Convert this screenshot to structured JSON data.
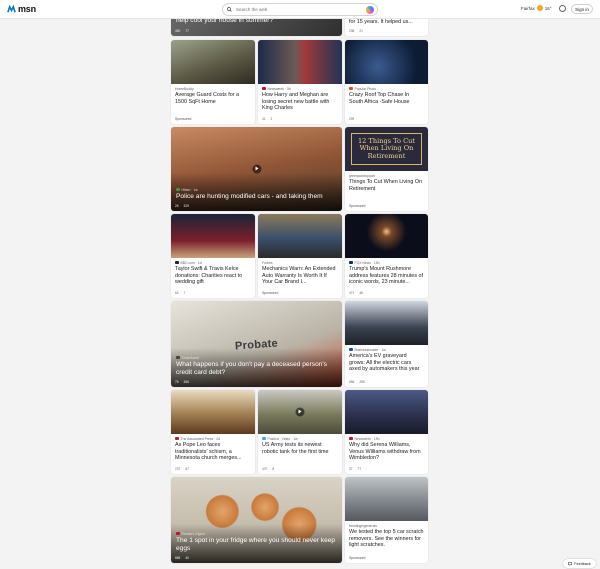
{
  "header": {
    "logo_text": "msn",
    "search_placeholder": "Search the web",
    "location": "Fairfax",
    "temperature": "16°",
    "signin_label": "Sign in"
  },
  "cards": {
    "c_top_left": {
      "title": "help cool your house in summer?",
      "likes": "450",
      "comments": "77"
    },
    "c_top_right": {
      "title": "for 15 years. It helped us...",
      "likes": "238",
      "comments": "21"
    },
    "c1": {
      "source": "HomeBuddy",
      "title": "Average Guard Costs for a 1500 SqFt Home",
      "sponsored": "Sponsored"
    },
    "c2": {
      "source": "Newsweek · 3h",
      "title": "How Harry and Meghan are losing secret new battle with King Charles",
      "likes": "41",
      "comments": "2"
    },
    "c3": {
      "source": "Popular Photo",
      "title": "Crazy Roof Top Chase In South Africa -Safe House",
      "likes": "299"
    },
    "c4": {
      "source": "Hiberi · 1w",
      "title": "Police are hunting modified cars - and taking them",
      "likes": "26",
      "comments": "329"
    },
    "c5": {
      "source": "greenpointopcom",
      "title": "Things To Cut When Living On Retirement",
      "poster": "12 Things To Cut When Living On Retirement",
      "sponsored": "Sponsored"
    },
    "c6": {
      "source": "BBC.com · 1d",
      "title": "Taylor Swift & Travis Kelce donations: Charities react to wedding gift",
      "likes": "64",
      "comments": "7"
    },
    "c7": {
      "source": "Forbes",
      "title": "Mechanics Warn: An Extended Auto Warranty Is Worth It If Your Car Brand I...",
      "sponsored": "Sponsored"
    },
    "c8": {
      "source": "FOX News · 15h",
      "title": "Trump's Mount Rushmore address features 28 minutes of iconic words, 23 minute...",
      "likes": "471",
      "comments": "46"
    },
    "c9": {
      "source": "SmartAsset",
      "title": "What happens if you don't pay a deceased person's credit card debt?",
      "probate": "Probate",
      "likes": "76",
      "comments": "366"
    },
    "c10": {
      "source": "BusinessInsider · 1w",
      "title": "America's EV graveyard grows: All the electric cars axed by automakers this year",
      "likes": "656",
      "comments": "285"
    },
    "c11": {
      "source": "The Associated Press · 2d",
      "title": "As Pope Leo faces traditionalists' schism, a Minnesota church merges...",
      "likes": "237",
      "comments": "67"
    },
    "c12": {
      "source": "Postiva · Video · 1w",
      "title": "US Army tests its newest robotic tank for the first time",
      "likes": "470",
      "comments": "8"
    },
    "c13": {
      "source": "Newsweek · 19h",
      "title": "Why did Serena Williams, Venus Williams withdraw from Wimbledon?",
      "likes": "37",
      "comments": "77"
    },
    "c14": {
      "source": "Readers Digest",
      "title": "The 1 spot in your fridge where you should never keep eggs",
      "likes": "865",
      "comments": "40"
    },
    "c15": {
      "source": "trendingingenerals",
      "title": "We tested the top 5 car scratch removers. See the winners for light scratches.",
      "sponsored": "Sponsored"
    }
  },
  "feedback_label": "Feedback",
  "colors": {
    "accent": "#0078d4",
    "sun": "#f5a623"
  }
}
